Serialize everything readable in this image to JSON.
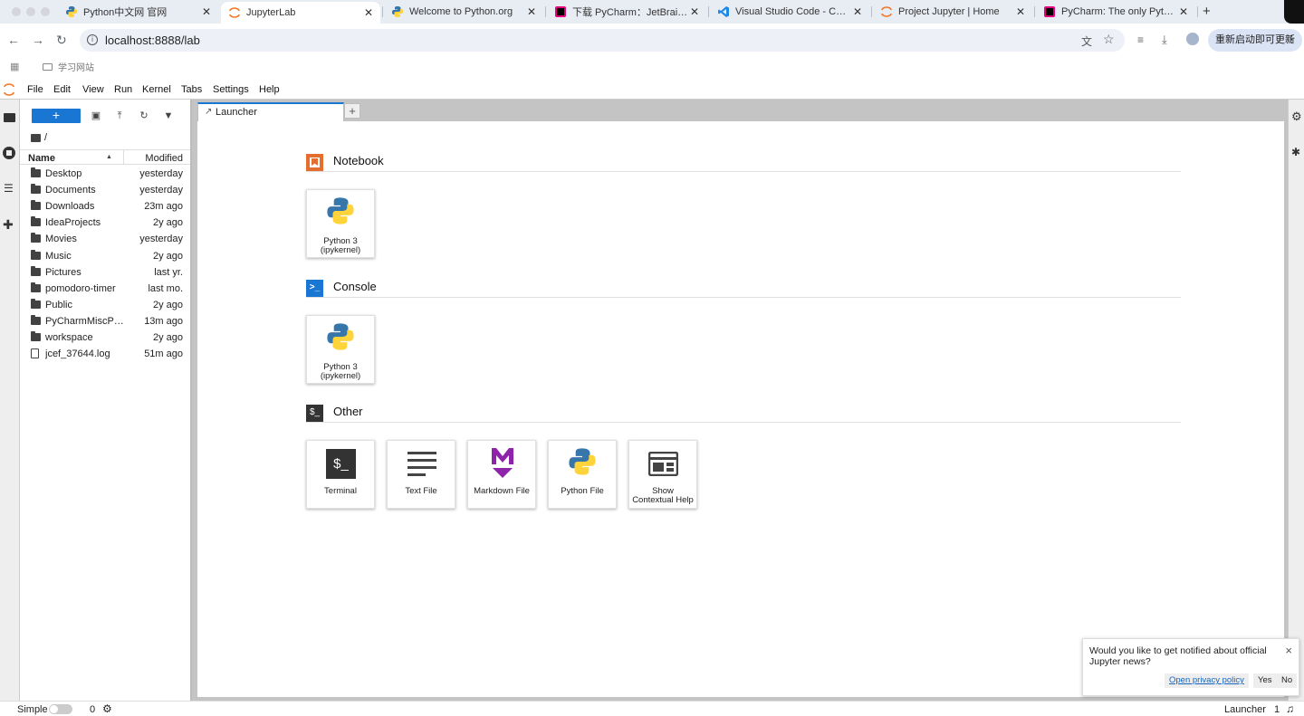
{
  "browser": {
    "tabs": [
      {
        "title": "Python中文网 官网",
        "favicon": "python-logo-icon"
      },
      {
        "title": "JupyterLab",
        "favicon": "jupyter-logo-icon",
        "active": true
      },
      {
        "title": "Welcome to Python.org",
        "favicon": "python-logo-icon"
      },
      {
        "title": "下载 PyCharm：JetBrains 出品",
        "favicon": "pycharm-logo-icon"
      },
      {
        "title": "Visual Studio Code - Code Editing",
        "favicon": "vscode-logo-icon"
      },
      {
        "title": "Project Jupyter | Home",
        "favicon": "jupyter-logo-icon"
      },
      {
        "title": "PyCharm: The only Python IDE",
        "favicon": "pycharm-logo-icon"
      }
    ],
    "new_tab": "+",
    "url": "localhost:8888/lab",
    "update_button": "重新启动即可更新",
    "bookmark": "学习网站"
  },
  "menu": [
    "File",
    "Edit",
    "View",
    "Run",
    "Kernel",
    "Tabs",
    "Settings",
    "Help"
  ],
  "filebrowser": {
    "new_label": "+",
    "path": "/",
    "col_name": "Name",
    "col_modified": "Modified",
    "files": [
      {
        "name": "Desktop",
        "modified": "yesterday",
        "kind": "folder"
      },
      {
        "name": "Documents",
        "modified": "yesterday",
        "kind": "folder"
      },
      {
        "name": "Downloads",
        "modified": "23m ago",
        "kind": "folder"
      },
      {
        "name": "IdeaProjects",
        "modified": "2y ago",
        "kind": "folder"
      },
      {
        "name": "Movies",
        "modified": "yesterday",
        "kind": "folder"
      },
      {
        "name": "Music",
        "modified": "2y ago",
        "kind": "folder"
      },
      {
        "name": "Pictures",
        "modified": "last yr.",
        "kind": "folder"
      },
      {
        "name": "pomodoro-timer",
        "modified": "last mo.",
        "kind": "folder"
      },
      {
        "name": "Public",
        "modified": "2y ago",
        "kind": "folder"
      },
      {
        "name": "PyCharmMiscProject",
        "modified": "13m ago",
        "kind": "folder"
      },
      {
        "name": "workspace",
        "modified": "2y ago",
        "kind": "folder"
      },
      {
        "name": "jcef_37644.log",
        "modified": "51m ago",
        "kind": "file"
      }
    ]
  },
  "launcher": {
    "tab_title": "Launcher",
    "sections": {
      "notebook": {
        "title": "Notebook",
        "cards": [
          "Python 3\n(ipykernel)"
        ]
      },
      "console": {
        "title": "Console",
        "cards": [
          "Python 3\n(ipykernel)"
        ]
      },
      "other": {
        "title": "Other",
        "cards": [
          "Terminal",
          "Text File",
          "Markdown File",
          "Python File",
          "Show\nContextual Help"
        ]
      }
    }
  },
  "notification": {
    "message": "Would you like to get notified about official Jupyter news?",
    "privacy_link": "Open privacy policy",
    "yes": "Yes",
    "no": "No",
    "close": "×"
  },
  "status": {
    "mode": "Simple",
    "kernel_count": "0",
    "active": "Launcher",
    "num": "1"
  },
  "colors": {
    "accent": "#1976d2",
    "notebook_icon": "#e46e2e",
    "markdown": "#8e24aa"
  }
}
